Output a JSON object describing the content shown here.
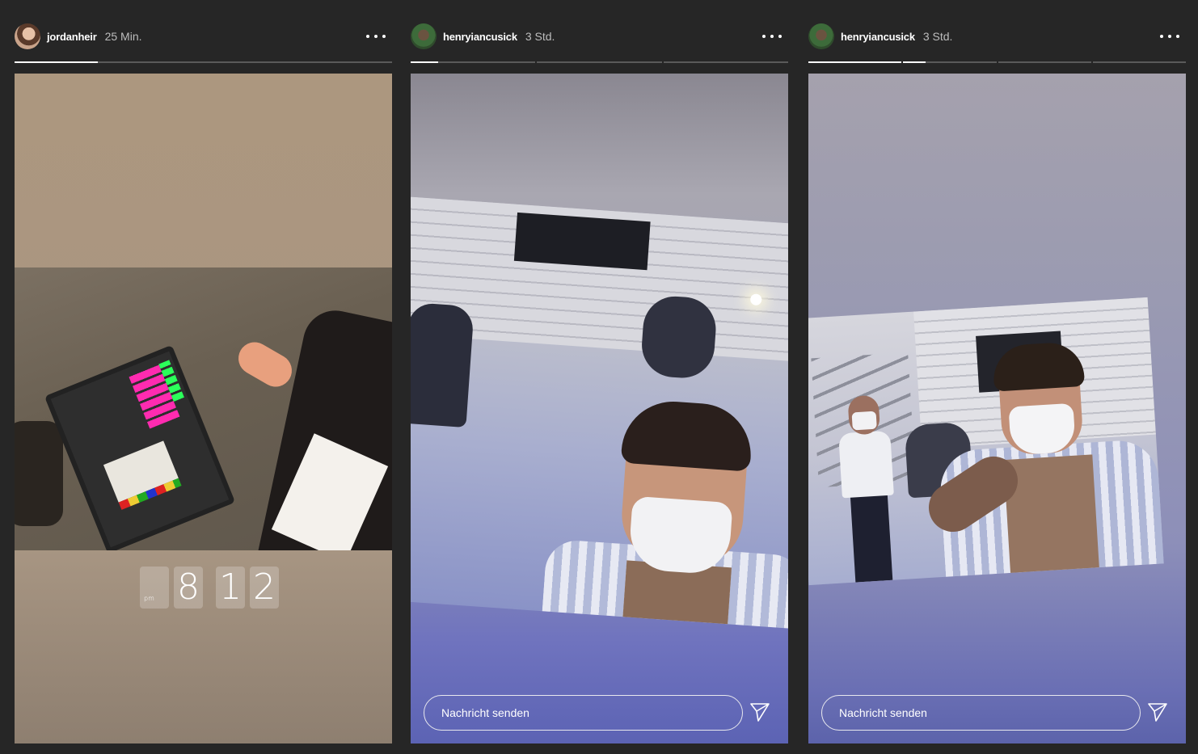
{
  "stories": [
    {
      "username": "jordanheir",
      "time": "25 Min.",
      "progress": [
        0.22
      ],
      "clock": {
        "h1": "",
        "h2": "8",
        "m1": "1",
        "m2": "2",
        "meridiem": "pm"
      }
    },
    {
      "username": "henryiancusick",
      "time": "3 Std.",
      "progress": [
        0.22,
        0,
        0
      ],
      "reply_placeholder": "Nachricht senden"
    },
    {
      "username": "henryiancusick",
      "time": "3 Std.",
      "progress": [
        1,
        0.24,
        0,
        0
      ],
      "reply_placeholder": "Nachricht senden"
    }
  ],
  "colors": {
    "background": "#262626",
    "progress_track": "#5a5a5a",
    "progress_fill": "#ffffff"
  }
}
